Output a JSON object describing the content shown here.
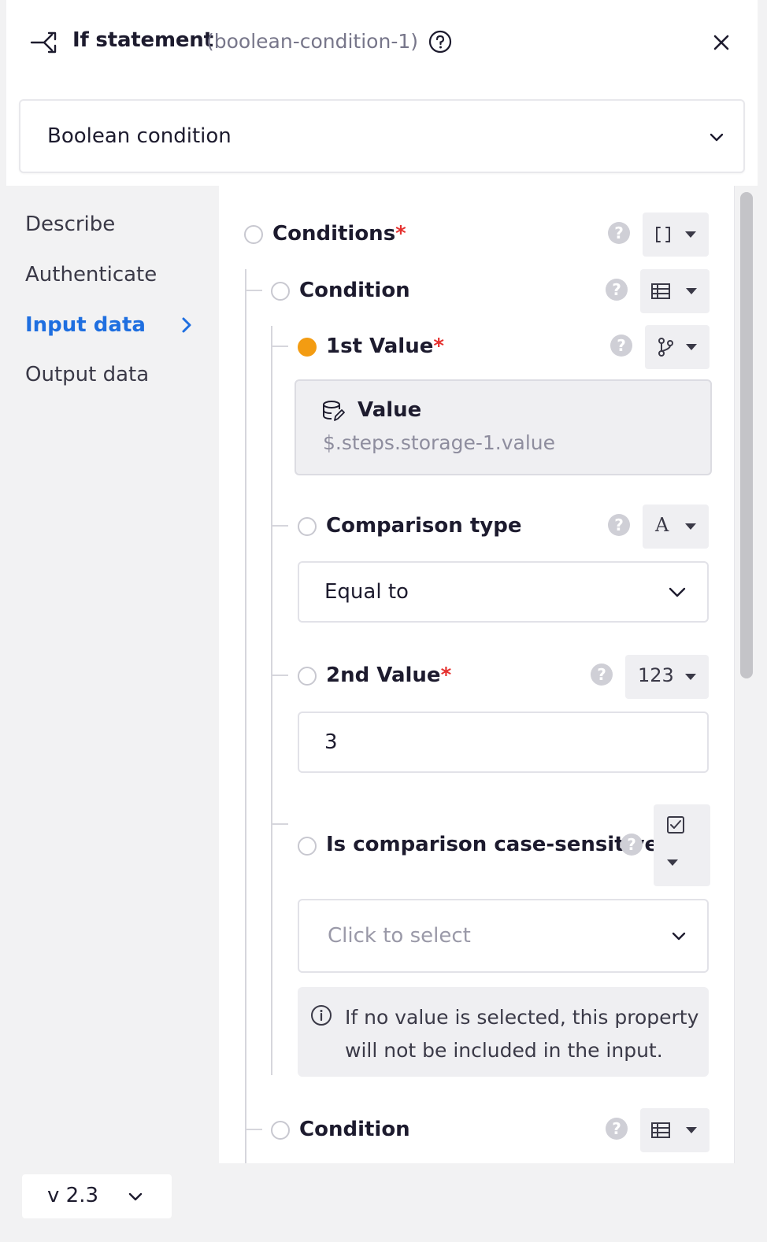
{
  "header": {
    "title": "If statement",
    "subtitle": "(boolean-condition-1)",
    "help_icon": "help-circle-icon",
    "close_icon": "close-icon"
  },
  "operation_select": {
    "value": "Boolean condition"
  },
  "sidebar": {
    "items": [
      {
        "label": "Describe",
        "active": false
      },
      {
        "label": "Authenticate",
        "active": false
      },
      {
        "label": "Input data",
        "active": true
      },
      {
        "label": "Output data",
        "active": false
      }
    ]
  },
  "fields": {
    "conditions": {
      "label": "Conditions",
      "required_mark": "*",
      "type_icon": "array-brackets-icon"
    },
    "condition": {
      "label": "Condition",
      "type_icon": "table-icon"
    },
    "first_value": {
      "label": "1st Value",
      "required_mark": "*",
      "type_icon": "branch-icon",
      "value_title": "Value",
      "value_path": "$.steps.storage-1.value"
    },
    "comparison_type": {
      "label": "Comparison type",
      "type_text": "A",
      "selected": "Equal to"
    },
    "second_value": {
      "label": "2nd Value",
      "required_mark": "*",
      "type_text": "123",
      "value": "3"
    },
    "case_sensitive": {
      "label": "Is comparison case-sensitive?",
      "placeholder": "Click to select",
      "info": "If no value is selected, this property will not be included in the input."
    },
    "condition_2": {
      "label": "Condition",
      "type_icon": "table-icon"
    }
  },
  "footer": {
    "version": "v 2.3"
  },
  "colors": {
    "accent": "#1f6fe0",
    "required": "#e5302e",
    "mapped_dot": "#f39c12"
  }
}
